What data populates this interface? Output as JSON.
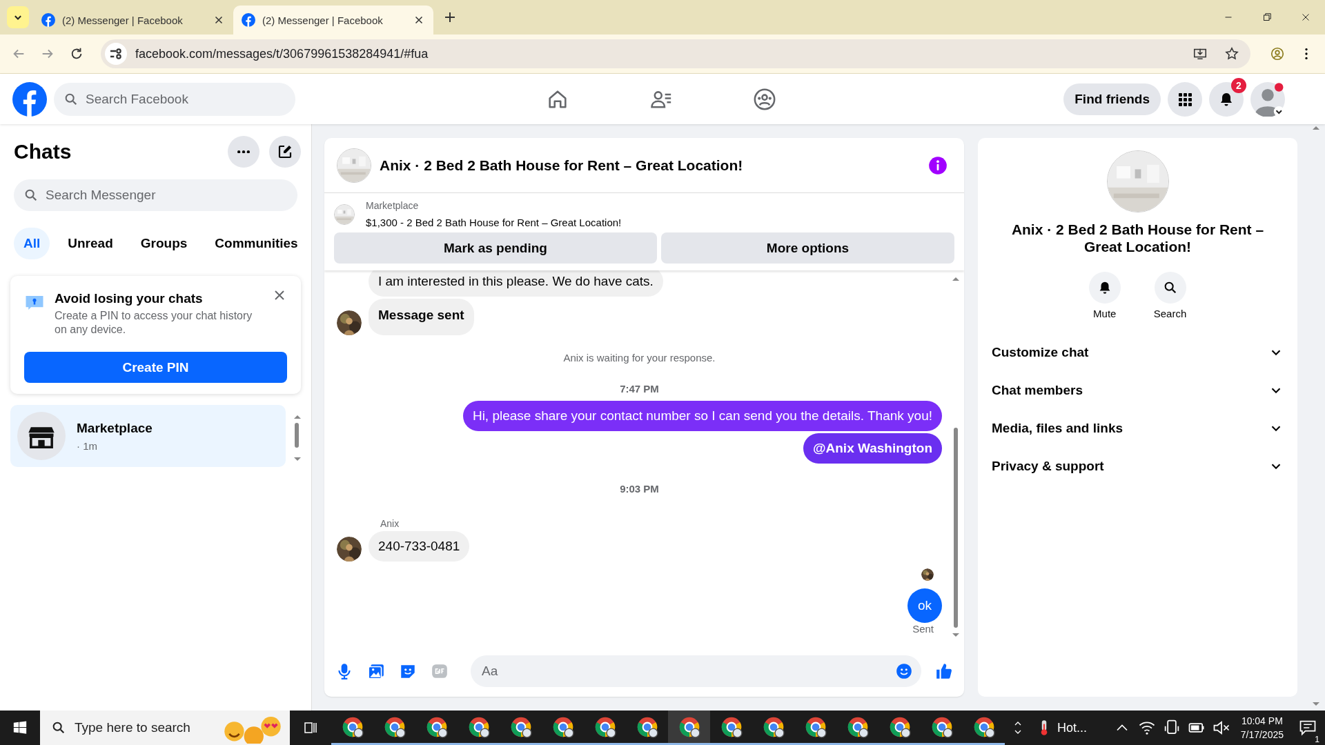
{
  "browser": {
    "tabs": [
      {
        "title": "(2) Messenger | Facebook",
        "selected": false
      },
      {
        "title": "(2) Messenger | Facebook",
        "selected": true
      }
    ],
    "url": "facebook.com/messages/t/30679961538284941/#fua"
  },
  "header": {
    "search_placeholder": "Search Facebook",
    "find_friends": "Find friends",
    "notification_count": "2"
  },
  "chats": {
    "title": "Chats",
    "search_placeholder": "Search Messenger",
    "filters": [
      {
        "label": "All",
        "selected": true
      },
      {
        "label": "Unread",
        "selected": false
      },
      {
        "label": "Groups",
        "selected": false
      },
      {
        "label": "Communities",
        "selected": false
      }
    ],
    "pin_card": {
      "title": "Avoid losing your chats",
      "text": "Create a PIN to access your chat history on any device.",
      "button": "Create PIN"
    },
    "conversations": [
      {
        "name": "Marketplace",
        "time": "· 1m",
        "selected": true
      }
    ]
  },
  "conversation": {
    "title": "Anix · 2 Bed 2 Bath House for Rent – Great Location!",
    "listing": {
      "label": "Marketplace",
      "text": "$1,300 - 2 Bed 2 Bath House for Rent – Great Location!"
    },
    "actions": [
      "Mark as pending",
      "More options"
    ],
    "messages": [
      {
        "kind": "incoming",
        "text": "I am interested in this please. We do have cats.",
        "bold": false,
        "avatar": false
      },
      {
        "kind": "incoming",
        "text": "Message sent",
        "bold": true,
        "avatar": true
      },
      {
        "kind": "notice",
        "text": "Anix is waiting for your response."
      },
      {
        "kind": "time",
        "text": "7:47 PM"
      },
      {
        "kind": "outgoing",
        "text": "Hi, please share your contact number so I can send you the details. Thank you!",
        "bold": false,
        "color": "#7b2ff7"
      },
      {
        "kind": "outgoing",
        "text": "@Anix Washington",
        "bold": true,
        "color": "#6a2ff0"
      },
      {
        "kind": "time",
        "text": "9:03 PM"
      },
      {
        "kind": "sender",
        "text": "Anix"
      },
      {
        "kind": "incoming",
        "text": "240-733-0481",
        "bold": false,
        "avatar": true
      },
      {
        "kind": "seen"
      },
      {
        "kind": "outgoing",
        "text": "ok",
        "bold": false,
        "color": "#0866ff"
      },
      {
        "kind": "receipt",
        "text": "Sent"
      }
    ],
    "composer_placeholder": "Aa"
  },
  "info": {
    "title": "Anix · 2 Bed 2 Bath House for Rent – Great Location!",
    "actions": [
      {
        "kind": "mute",
        "label": "Mute"
      },
      {
        "kind": "search",
        "label": "Search"
      }
    ],
    "sections": [
      "Customize chat",
      "Chat members",
      "Media, files and links",
      "Privacy & support"
    ]
  },
  "taskbar": {
    "search_placeholder": "Type here to search",
    "apps": [
      {
        "selected": false
      },
      {
        "selected": false
      },
      {
        "selected": false
      },
      {
        "selected": false
      },
      {
        "selected": false
      },
      {
        "selected": false
      },
      {
        "selected": false
      },
      {
        "selected": false
      },
      {
        "selected": true
      },
      {
        "selected": false
      },
      {
        "selected": false
      },
      {
        "selected": false
      },
      {
        "selected": false
      },
      {
        "selected": false
      },
      {
        "selected": false
      },
      {
        "selected": false
      }
    ],
    "weather": "Hot...",
    "time": "10:04 PM",
    "date": "7/17/2025",
    "notification_count": "1"
  }
}
